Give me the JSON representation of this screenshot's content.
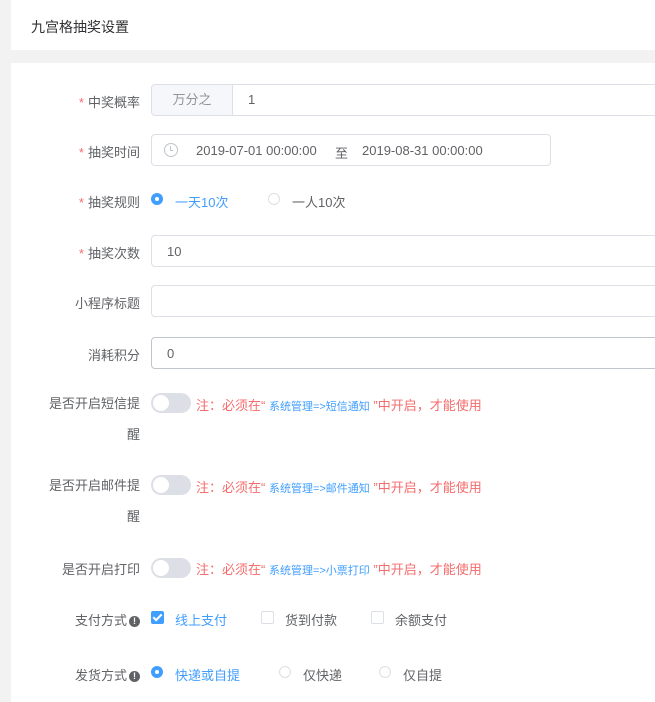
{
  "header": {
    "title": "九宫格抽奖设置"
  },
  "form": {
    "probability": {
      "label": "中奖概率",
      "prepend": "万分之",
      "value": "1"
    },
    "lottery_time": {
      "label": "抽奖时间",
      "start": "2019-07-01 00:00:00",
      "separator": "至",
      "end": "2019-08-31 00:00:00"
    },
    "lottery_rule": {
      "label": "抽奖规则",
      "options": [
        "一天10次",
        "一人10次"
      ],
      "selected": 0
    },
    "lottery_count": {
      "label": "抽奖次数",
      "value": "10"
    },
    "mini_title": {
      "label": "小程序标题",
      "value": ""
    },
    "points_cost": {
      "label": "消耗积分",
      "value": "0"
    },
    "sms_switch": {
      "label_line1": "是否开启短信提",
      "label_line2": "醒",
      "note_prefix": "注：必须在“ ",
      "note_link": "系统管理=>短信通知",
      "note_suffix": " ”中开启，才能使用",
      "enabled": false
    },
    "mail_switch": {
      "label_line1": "是否开启邮件提",
      "label_line2": "醒",
      "note_prefix": "注：必须在“ ",
      "note_link": "系统管理=>邮件通知",
      "note_suffix": " ”中开启，才能使用",
      "enabled": false
    },
    "print_switch": {
      "label": "是否开启打印",
      "note_prefix": "注：必须在“ ",
      "note_link": "系统管理=>小票打印",
      "note_suffix": " ”中开启，才能使用",
      "enabled": false
    },
    "payment": {
      "label": "支付方式",
      "options": [
        "线上支付",
        "货到付款",
        "余额支付"
      ],
      "checked": [
        true,
        false,
        false
      ]
    },
    "delivery": {
      "label": "发货方式",
      "options": [
        "快递或自提",
        "仅快递",
        "仅自提"
      ],
      "selected": 0
    }
  },
  "colors": {
    "primary": "#409eff",
    "danger": "#f56c6c",
    "text": "#606266"
  }
}
